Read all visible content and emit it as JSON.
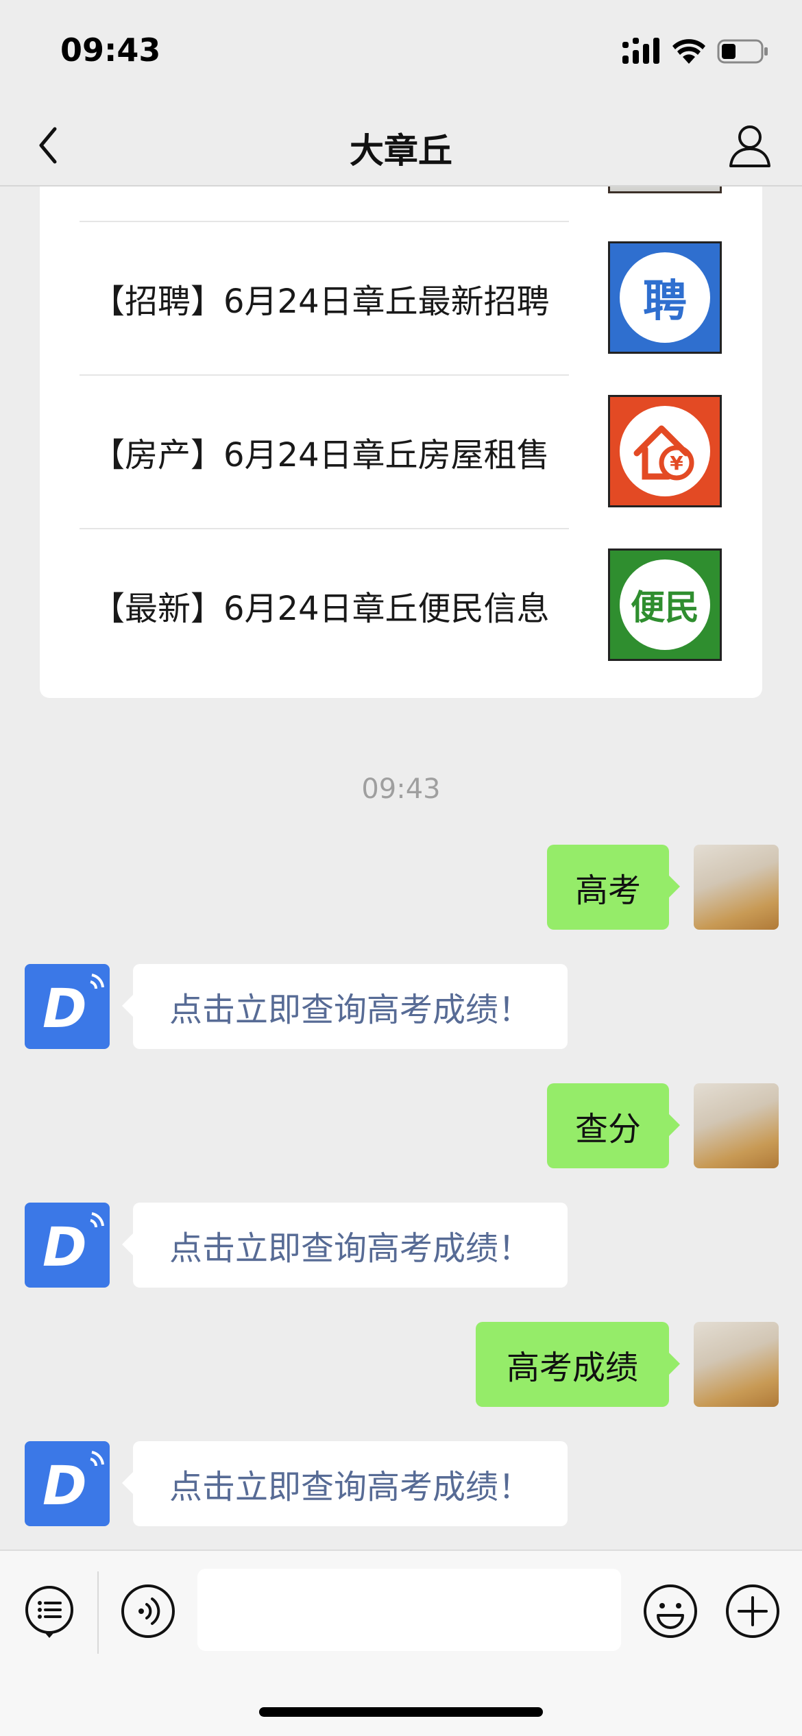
{
  "status_bar": {
    "time": "09:43"
  },
  "nav": {
    "title": "大章丘"
  },
  "articles": [
    {
      "title": "【招聘】6月24日章丘最新招聘",
      "thumb_text": "聘",
      "thumb_color": "#2f6fcf"
    },
    {
      "title": "【房产】6月24日章丘房屋租售",
      "thumb_text": "¥",
      "thumb_color": "#e34a24"
    },
    {
      "title": "【最新】6月24日章丘便民信息",
      "thumb_text": "便民",
      "thumb_color": "#2f8e2f"
    }
  ],
  "timestamp": "09:43",
  "messages": [
    {
      "from": "me",
      "text": "高考"
    },
    {
      "from": "bot",
      "text": "点击立即查询高考成绩！"
    },
    {
      "from": "me",
      "text": "查分"
    },
    {
      "from": "bot",
      "text": "点击立即查询高考成绩！"
    },
    {
      "from": "me",
      "text": "高考成绩"
    },
    {
      "from": "bot",
      "text": "点击立即查询高考成绩！"
    }
  ],
  "bot_avatar_letter": "D",
  "input": {
    "value": ""
  }
}
